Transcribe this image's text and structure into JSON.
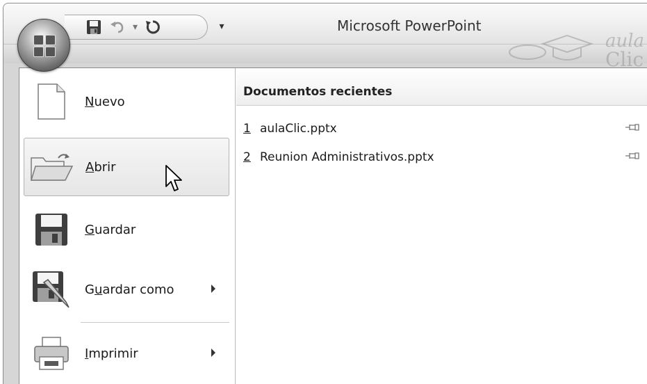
{
  "window": {
    "title": "Microsoft PowerPoint"
  },
  "quick_access": {
    "save": "save-icon",
    "undo": "undo-icon",
    "undo_dropdown": "▾",
    "redo": "redo-icon",
    "customize": "▾"
  },
  "watermark": {
    "text_line1": "aula",
    "text_line2": "Clic"
  },
  "menu": {
    "items": [
      {
        "label_ul": "N",
        "label_rest": "uevo",
        "icon": "new-document-icon"
      },
      {
        "label_ul": "A",
        "label_rest": "brir",
        "icon": "open-folder-icon"
      },
      {
        "label_ul": "G",
        "label_rest": "uardar",
        "icon": "save-icon"
      },
      {
        "label_pre": "G",
        "label_ul": "u",
        "label_rest": "ardar como",
        "icon": "save-as-icon",
        "submenu": true
      },
      {
        "label_ul": "I",
        "label_rest": "mprimir",
        "icon": "print-icon",
        "submenu": true
      }
    ]
  },
  "recent": {
    "title": "Documentos recientes",
    "documents": [
      {
        "num": "1",
        "name": "aulaClic.pptx"
      },
      {
        "num": "2",
        "name": "Reunion Administrativos.pptx"
      }
    ]
  },
  "colors": {
    "hover_bg": "#ececec",
    "border": "#8a8a8a"
  }
}
